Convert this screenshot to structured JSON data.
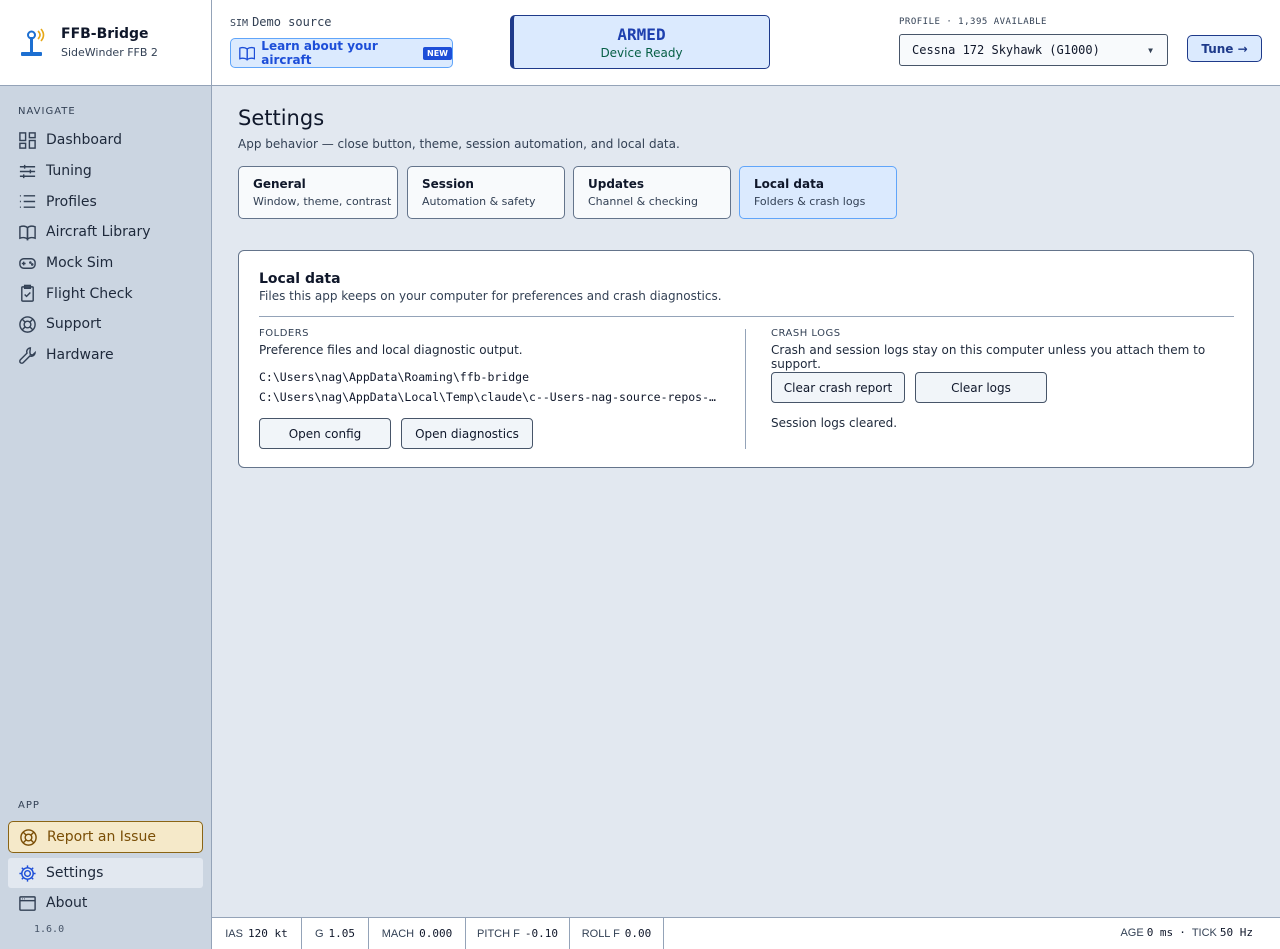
{
  "app": {
    "name": "FFB-Bridge",
    "device": "SideWinder FFB 2",
    "version": "1.6.0"
  },
  "sidebar": {
    "navigate_heading": "NAVIGATE",
    "items": [
      {
        "label": "Dashboard",
        "icon": "dashboard-icon"
      },
      {
        "label": "Tuning",
        "icon": "sliders-icon"
      },
      {
        "label": "Profiles",
        "icon": "list-icon"
      },
      {
        "label": "Aircraft Library",
        "icon": "book-icon"
      },
      {
        "label": "Mock Sim",
        "icon": "gamepad-icon"
      },
      {
        "label": "Flight Check",
        "icon": "clipboard-check-icon"
      },
      {
        "label": "Support",
        "icon": "lifebuoy-icon"
      },
      {
        "label": "Hardware",
        "icon": "wrench-icon"
      }
    ],
    "app_heading": "APP",
    "report": "Report an Issue",
    "settings": "Settings",
    "about": "About"
  },
  "topbar": {
    "sim_label": "SIM",
    "sim_value": "Demo source",
    "learn": "Learn about your aircraft",
    "learn_badge": "NEW",
    "armed_title": "ARMED",
    "armed_sub": "Device Ready",
    "profile_label": "PROFILE · 1,395 AVAILABLE",
    "profile_value": "Cessna 172 Skyhawk (G1000)",
    "tune": "Tune →"
  },
  "settings": {
    "title": "Settings",
    "subtitle": "App behavior — close button, theme, session automation, and local data.",
    "tabs": [
      {
        "title": "General",
        "sub": "Window, theme, contrast"
      },
      {
        "title": "Session",
        "sub": "Automation & safety"
      },
      {
        "title": "Updates",
        "sub": "Channel & checking"
      },
      {
        "title": "Local data",
        "sub": "Folders & crash logs"
      }
    ],
    "active_tab": "Local data"
  },
  "local_data": {
    "title": "Local data",
    "subtitle": "Files this app keeps on your computer for preferences and crash diagnostics.",
    "folders_label": "FOLDERS",
    "folders_sub": "Preference files and local diagnostic output.",
    "paths": [
      "C:\\Users\\nag\\AppData\\Roaming\\ffb-bridge",
      "C:\\Users\\nag\\AppData\\Local\\Temp\\claude\\c--Users-nag-source-repos-…"
    ],
    "open_config": "Open config",
    "open_diagnostics": "Open diagnostics",
    "crash_label": "CRASH LOGS",
    "crash_sub": "Crash and session logs stay on this computer unless you attach them to support.",
    "clear_crash": "Clear crash report",
    "clear_logs": "Clear logs",
    "status": "Session logs cleared."
  },
  "statusbar": {
    "ias_k": "IAS",
    "ias_v": "120 kt",
    "g_k": "G",
    "g_v": "1.05",
    "mach_k": "MACH",
    "mach_v": "0.000",
    "pitch_k": "PITCH F",
    "pitch_v": "-0.10",
    "roll_k": "ROLL F",
    "roll_v": "0.00",
    "age_k": "AGE",
    "age_v": "0 ms",
    "tick_k": "TICK",
    "tick_v": "50 Hz",
    "sep": "·"
  },
  "colors": {
    "accent": "#1d4ed8",
    "armed_bg": "#dbeafe",
    "report_border": "#8a6414"
  }
}
